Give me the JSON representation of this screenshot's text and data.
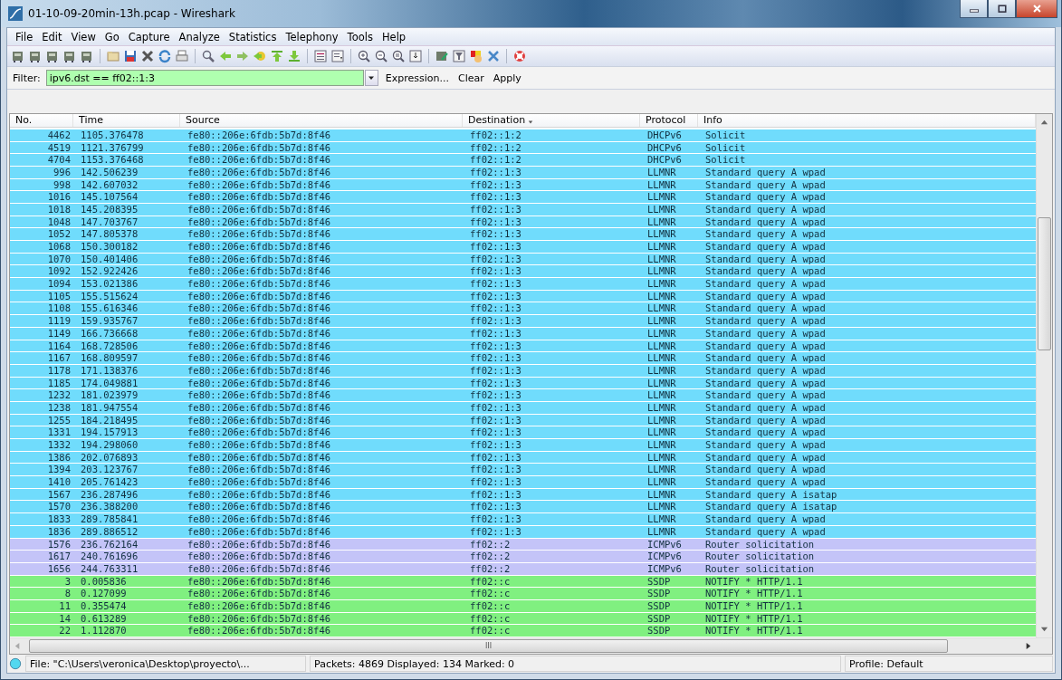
{
  "window": {
    "title": "01-10-09-20min-13h.pcap - Wireshark"
  },
  "menu": [
    "File",
    "Edit",
    "View",
    "Go",
    "Capture",
    "Analyze",
    "Statistics",
    "Telephony",
    "Tools",
    "Help"
  ],
  "filter": {
    "label": "Filter:",
    "value": "ipv6.dst == ff02::1:3",
    "buttons": [
      "Expression...",
      "Clear",
      "Apply"
    ]
  },
  "table": {
    "columns": [
      "No.",
      "Time",
      "Source",
      "Destination",
      "Protocol",
      "Info"
    ],
    "rows": [
      {
        "no": "4462",
        "time": "1105.376478",
        "source": "fe80::206e:6fdb:5b7d:8f46",
        "destination": "ff02::1:2",
        "protocol": "DHCPv6",
        "info": "Solicit",
        "color": "#70dcfc"
      },
      {
        "no": "4519",
        "time": "1121.376799",
        "source": "fe80::206e:6fdb:5b7d:8f46",
        "destination": "ff02::1:2",
        "protocol": "DHCPv6",
        "info": "Solicit",
        "color": "#70dcfc"
      },
      {
        "no": "4704",
        "time": "1153.376468",
        "source": "fe80::206e:6fdb:5b7d:8f46",
        "destination": "ff02::1:2",
        "protocol": "DHCPv6",
        "info": "Solicit",
        "color": "#70dcfc"
      },
      {
        "no": "996",
        "time": "142.506239",
        "source": "fe80::206e:6fdb:5b7d:8f46",
        "destination": "ff02::1:3",
        "protocol": "LLMNR",
        "info": "Standard query A wpad",
        "color": "#70dcfc"
      },
      {
        "no": "998",
        "time": "142.607032",
        "source": "fe80::206e:6fdb:5b7d:8f46",
        "destination": "ff02::1:3",
        "protocol": "LLMNR",
        "info": "Standard query A wpad",
        "color": "#70dcfc"
      },
      {
        "no": "1016",
        "time": "145.107564",
        "source": "fe80::206e:6fdb:5b7d:8f46",
        "destination": "ff02::1:3",
        "protocol": "LLMNR",
        "info": "Standard query A wpad",
        "color": "#70dcfc"
      },
      {
        "no": "1018",
        "time": "145.208395",
        "source": "fe80::206e:6fdb:5b7d:8f46",
        "destination": "ff02::1:3",
        "protocol": "LLMNR",
        "info": "Standard query A wpad",
        "color": "#70dcfc"
      },
      {
        "no": "1048",
        "time": "147.703767",
        "source": "fe80::206e:6fdb:5b7d:8f46",
        "destination": "ff02::1:3",
        "protocol": "LLMNR",
        "info": "Standard query A wpad",
        "color": "#70dcfc"
      },
      {
        "no": "1052",
        "time": "147.805378",
        "source": "fe80::206e:6fdb:5b7d:8f46",
        "destination": "ff02::1:3",
        "protocol": "LLMNR",
        "info": "Standard query A wpad",
        "color": "#70dcfc"
      },
      {
        "no": "1068",
        "time": "150.300182",
        "source": "fe80::206e:6fdb:5b7d:8f46",
        "destination": "ff02::1:3",
        "protocol": "LLMNR",
        "info": "Standard query A wpad",
        "color": "#70dcfc"
      },
      {
        "no": "1070",
        "time": "150.401406",
        "source": "fe80::206e:6fdb:5b7d:8f46",
        "destination": "ff02::1:3",
        "protocol": "LLMNR",
        "info": "Standard query A wpad",
        "color": "#70dcfc"
      },
      {
        "no": "1092",
        "time": "152.922426",
        "source": "fe80::206e:6fdb:5b7d:8f46",
        "destination": "ff02::1:3",
        "protocol": "LLMNR",
        "info": "Standard query A wpad",
        "color": "#70dcfc"
      },
      {
        "no": "1094",
        "time": "153.021386",
        "source": "fe80::206e:6fdb:5b7d:8f46",
        "destination": "ff02::1:3",
        "protocol": "LLMNR",
        "info": "Standard query A wpad",
        "color": "#70dcfc"
      },
      {
        "no": "1105",
        "time": "155.515624",
        "source": "fe80::206e:6fdb:5b7d:8f46",
        "destination": "ff02::1:3",
        "protocol": "LLMNR",
        "info": "Standard query A wpad",
        "color": "#70dcfc"
      },
      {
        "no": "1108",
        "time": "155.616346",
        "source": "fe80::206e:6fdb:5b7d:8f46",
        "destination": "ff02::1:3",
        "protocol": "LLMNR",
        "info": "Standard query A wpad",
        "color": "#70dcfc"
      },
      {
        "no": "1119",
        "time": "159.935767",
        "source": "fe80::206e:6fdb:5b7d:8f46",
        "destination": "ff02::1:3",
        "protocol": "LLMNR",
        "info": "Standard query A wpad",
        "color": "#70dcfc"
      },
      {
        "no": "1149",
        "time": "166.736668",
        "source": "fe80::206e:6fdb:5b7d:8f46",
        "destination": "ff02::1:3",
        "protocol": "LLMNR",
        "info": "Standard query A wpad",
        "color": "#70dcfc"
      },
      {
        "no": "1164",
        "time": "168.728506",
        "source": "fe80::206e:6fdb:5b7d:8f46",
        "destination": "ff02::1:3",
        "protocol": "LLMNR",
        "info": "Standard query A wpad",
        "color": "#70dcfc"
      },
      {
        "no": "1167",
        "time": "168.809597",
        "source": "fe80::206e:6fdb:5b7d:8f46",
        "destination": "ff02::1:3",
        "protocol": "LLMNR",
        "info": "Standard query A wpad",
        "color": "#70dcfc"
      },
      {
        "no": "1178",
        "time": "171.138376",
        "source": "fe80::206e:6fdb:5b7d:8f46",
        "destination": "ff02::1:3",
        "protocol": "LLMNR",
        "info": "Standard query A wpad",
        "color": "#70dcfc"
      },
      {
        "no": "1185",
        "time": "174.049881",
        "source": "fe80::206e:6fdb:5b7d:8f46",
        "destination": "ff02::1:3",
        "protocol": "LLMNR",
        "info": "Standard query A wpad",
        "color": "#70dcfc"
      },
      {
        "no": "1232",
        "time": "181.023979",
        "source": "fe80::206e:6fdb:5b7d:8f46",
        "destination": "ff02::1:3",
        "protocol": "LLMNR",
        "info": "Standard query A wpad",
        "color": "#70dcfc"
      },
      {
        "no": "1238",
        "time": "181.947554",
        "source": "fe80::206e:6fdb:5b7d:8f46",
        "destination": "ff02::1:3",
        "protocol": "LLMNR",
        "info": "Standard query A wpad",
        "color": "#70dcfc"
      },
      {
        "no": "1255",
        "time": "184.218495",
        "source": "fe80::206e:6fdb:5b7d:8f46",
        "destination": "ff02::1:3",
        "protocol": "LLMNR",
        "info": "Standard query A wpad",
        "color": "#70dcfc"
      },
      {
        "no": "1331",
        "time": "194.157913",
        "source": "fe80::206e:6fdb:5b7d:8f46",
        "destination": "ff02::1:3",
        "protocol": "LLMNR",
        "info": "Standard query A wpad",
        "color": "#70dcfc"
      },
      {
        "no": "1332",
        "time": "194.298060",
        "source": "fe80::206e:6fdb:5b7d:8f46",
        "destination": "ff02::1:3",
        "protocol": "LLMNR",
        "info": "Standard query A wpad",
        "color": "#70dcfc"
      },
      {
        "no": "1386",
        "time": "202.076893",
        "source": "fe80::206e:6fdb:5b7d:8f46",
        "destination": "ff02::1:3",
        "protocol": "LLMNR",
        "info": "Standard query A wpad",
        "color": "#70dcfc"
      },
      {
        "no": "1394",
        "time": "203.123767",
        "source": "fe80::206e:6fdb:5b7d:8f46",
        "destination": "ff02::1:3",
        "protocol": "LLMNR",
        "info": "Standard query A wpad",
        "color": "#70dcfc"
      },
      {
        "no": "1410",
        "time": "205.761423",
        "source": "fe80::206e:6fdb:5b7d:8f46",
        "destination": "ff02::1:3",
        "protocol": "LLMNR",
        "info": "Standard query A wpad",
        "color": "#70dcfc"
      },
      {
        "no": "1567",
        "time": "236.287496",
        "source": "fe80::206e:6fdb:5b7d:8f46",
        "destination": "ff02::1:3",
        "protocol": "LLMNR",
        "info": "Standard query A isatap",
        "color": "#70dcfc"
      },
      {
        "no": "1570",
        "time": "236.388200",
        "source": "fe80::206e:6fdb:5b7d:8f46",
        "destination": "ff02::1:3",
        "protocol": "LLMNR",
        "info": "Standard query A isatap",
        "color": "#70dcfc"
      },
      {
        "no": "1833",
        "time": "289.785841",
        "source": "fe80::206e:6fdb:5b7d:8f46",
        "destination": "ff02::1:3",
        "protocol": "LLMNR",
        "info": "Standard query A wpad",
        "color": "#70dcfc"
      },
      {
        "no": "1836",
        "time": "289.886512",
        "source": "fe80::206e:6fdb:5b7d:8f46",
        "destination": "ff02::1:3",
        "protocol": "LLMNR",
        "info": "Standard query A wpad",
        "color": "#70dcfc"
      },
      {
        "no": "1576",
        "time": "236.762164",
        "source": "fe80::206e:6fdb:5b7d:8f46",
        "destination": "ff02::2",
        "protocol": "ICMPv6",
        "info": "Router solicitation",
        "color": "#c4c4f8"
      },
      {
        "no": "1617",
        "time": "240.761696",
        "source": "fe80::206e:6fdb:5b7d:8f46",
        "destination": "ff02::2",
        "protocol": "ICMPv6",
        "info": "Router solicitation",
        "color": "#c4c4f8"
      },
      {
        "no": "1656",
        "time": "244.763311",
        "source": "fe80::206e:6fdb:5b7d:8f46",
        "destination": "ff02::2",
        "protocol": "ICMPv6",
        "info": "Router solicitation",
        "color": "#c4c4f8"
      },
      {
        "no": "3",
        "time": "0.005836",
        "source": "fe80::206e:6fdb:5b7d:8f46",
        "destination": "ff02::c",
        "protocol": "SSDP",
        "info": "NOTIFY * HTTP/1.1",
        "color": "#80f080"
      },
      {
        "no": "8",
        "time": "0.127099",
        "source": "fe80::206e:6fdb:5b7d:8f46",
        "destination": "ff02::c",
        "protocol": "SSDP",
        "info": "NOTIFY * HTTP/1.1",
        "color": "#80f080"
      },
      {
        "no": "11",
        "time": "0.355474",
        "source": "fe80::206e:6fdb:5b7d:8f46",
        "destination": "ff02::c",
        "protocol": "SSDP",
        "info": "NOTIFY * HTTP/1.1",
        "color": "#80f080"
      },
      {
        "no": "14",
        "time": "0.613289",
        "source": "fe80::206e:6fdb:5b7d:8f46",
        "destination": "ff02::c",
        "protocol": "SSDP",
        "info": "NOTIFY * HTTP/1.1",
        "color": "#80f080"
      },
      {
        "no": "22",
        "time": "1.112870",
        "source": "fe80::206e:6fdb:5b7d:8f46",
        "destination": "ff02::c",
        "protocol": "SSDP",
        "info": "NOTIFY * HTTP/1.1",
        "color": "#80f080"
      }
    ]
  },
  "horizontal_scrollbar": {
    "grip": "III"
  },
  "status_bar": {
    "file": "File: \"C:\\Users\\veronica\\Desktop\\proyecto\\...",
    "packets": "Packets: 4869 Displayed: 134 Marked: 0",
    "profile": "Profile: Default"
  }
}
